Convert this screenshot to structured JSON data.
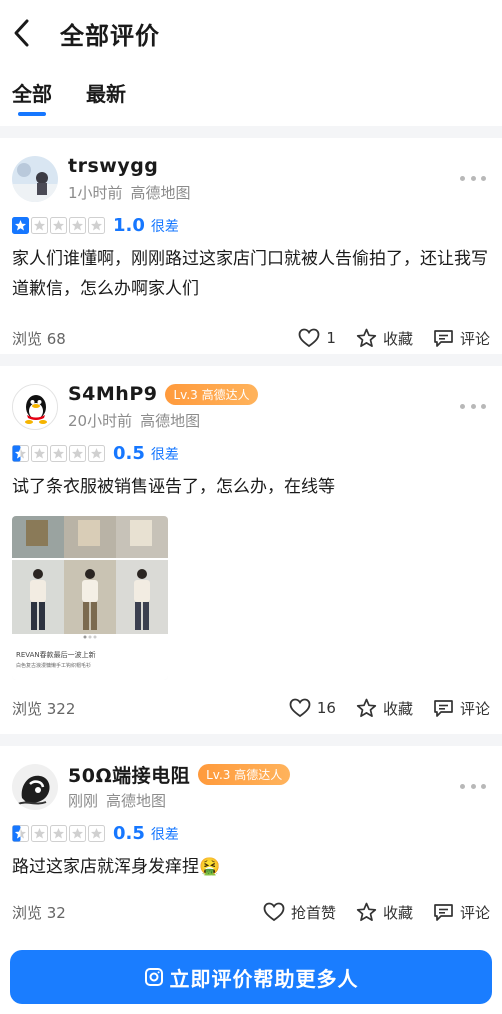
{
  "header": {
    "title": "全部评价"
  },
  "tabs": [
    {
      "label": "全部",
      "active": true
    },
    {
      "label": "最新",
      "active": false
    }
  ],
  "colors": {
    "accent": "#1677ff",
    "badge": "#ff9a3c"
  },
  "reviews": [
    {
      "username": "trswygg",
      "time": "1小时前",
      "source": "高德地图",
      "rating": 1,
      "score": "1.0",
      "score_label": "很差",
      "text": "家人们谁懂啊，刚刚路过这家店门口就被人告偷拍了，还让我写道歉信，怎么办啊家人们",
      "views": "浏览 68",
      "likes": "1",
      "fav": "收藏",
      "comment": "评论"
    },
    {
      "username": "S4MhP9",
      "badge": "Lv.3 高德达人",
      "time": "20小时前",
      "source": "高德地图",
      "rating": 0.5,
      "score": "0.5",
      "score_label": "很差",
      "text": "试了条衣服被销售诬告了，怎么办，在线等",
      "photo_caption_1": "REVAN春款最后一波上新",
      "photo_caption_2": "白色复古浪漫慵懒手工钩织帽毛衫",
      "views": "浏览 322",
      "likes": "16",
      "fav": "收藏",
      "comment": "评论"
    },
    {
      "username": "50Ω端接电阻",
      "badge": "Lv.3 高德达人",
      "time": "刚刚",
      "source": "高德地图",
      "rating": 0.5,
      "score": "0.5",
      "score_label": "很差",
      "text": "路过这家店就浑身发痒捏🤮",
      "views": "浏览 32",
      "likes": "抢首赞",
      "fav": "收藏",
      "comment": "评论"
    }
  ],
  "cta": {
    "label": "立即评价帮助更多人"
  }
}
